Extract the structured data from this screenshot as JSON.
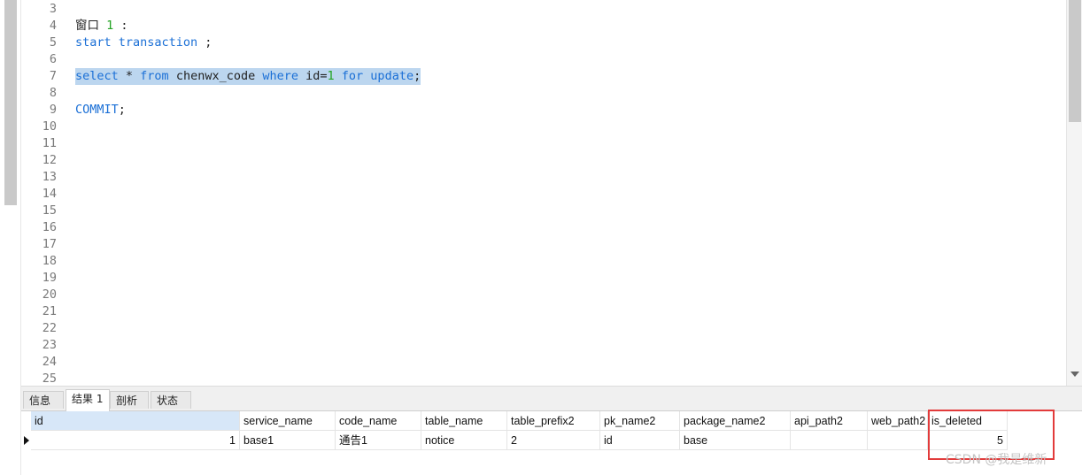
{
  "editor": {
    "lines": [
      {
        "n": "3",
        "parts": []
      },
      {
        "n": "4",
        "parts": [
          {
            "t": "窗口 ",
            "c": ""
          },
          {
            "t": "1",
            "c": "num"
          },
          {
            "t": " :",
            "c": ""
          }
        ]
      },
      {
        "n": "5",
        "parts": [
          {
            "t": "start transaction",
            "c": "kw"
          },
          {
            "t": " ;",
            "c": ""
          }
        ]
      },
      {
        "n": "6",
        "parts": []
      },
      {
        "n": "7",
        "selected": true,
        "parts": [
          {
            "t": "select",
            "c": "kw"
          },
          {
            "t": " * ",
            "c": ""
          },
          {
            "t": "from",
            "c": "kw"
          },
          {
            "t": " chenwx_code ",
            "c": ""
          },
          {
            "t": "where",
            "c": "kw"
          },
          {
            "t": " id=",
            "c": ""
          },
          {
            "t": "1",
            "c": "num"
          },
          {
            "t": " ",
            "c": ""
          },
          {
            "t": "for update",
            "c": "kw"
          },
          {
            "t": ";",
            "c": ""
          }
        ]
      },
      {
        "n": "8",
        "parts": []
      },
      {
        "n": "9",
        "parts": [
          {
            "t": "COMMIT",
            "c": "kw"
          },
          {
            "t": ";",
            "c": ""
          }
        ]
      },
      {
        "n": "10",
        "parts": []
      },
      {
        "n": "11",
        "parts": []
      },
      {
        "n": "12",
        "parts": []
      },
      {
        "n": "13",
        "parts": []
      },
      {
        "n": "14",
        "parts": []
      },
      {
        "n": "15",
        "parts": []
      },
      {
        "n": "16",
        "parts": []
      },
      {
        "n": "17",
        "parts": []
      },
      {
        "n": "18",
        "parts": []
      },
      {
        "n": "19",
        "parts": []
      },
      {
        "n": "20",
        "parts": []
      },
      {
        "n": "21",
        "parts": []
      },
      {
        "n": "22",
        "parts": []
      },
      {
        "n": "23",
        "parts": []
      },
      {
        "n": "24",
        "parts": []
      },
      {
        "n": "25",
        "parts": []
      }
    ]
  },
  "tabs": {
    "info": "信息",
    "result": "结果 1",
    "profile": "剖析",
    "status": "状态",
    "active": "result"
  },
  "grid": {
    "columns": [
      "id",
      "service_name",
      "code_name",
      "table_name",
      "table_prefix2",
      "pk_name2",
      "package_name2",
      "api_path2",
      "web_path2",
      "is_deleted"
    ],
    "rows": [
      [
        "1",
        "base1",
        "通告1",
        "notice",
        "2",
        "id",
        "base",
        "",
        "",
        "5"
      ]
    ]
  },
  "watermark": "CSDN @我是维新",
  "colors": {
    "keyword": "#1a6fd6",
    "number": "#23a423",
    "selection": "#bcd6ef",
    "highlight": "#e23b3b"
  }
}
